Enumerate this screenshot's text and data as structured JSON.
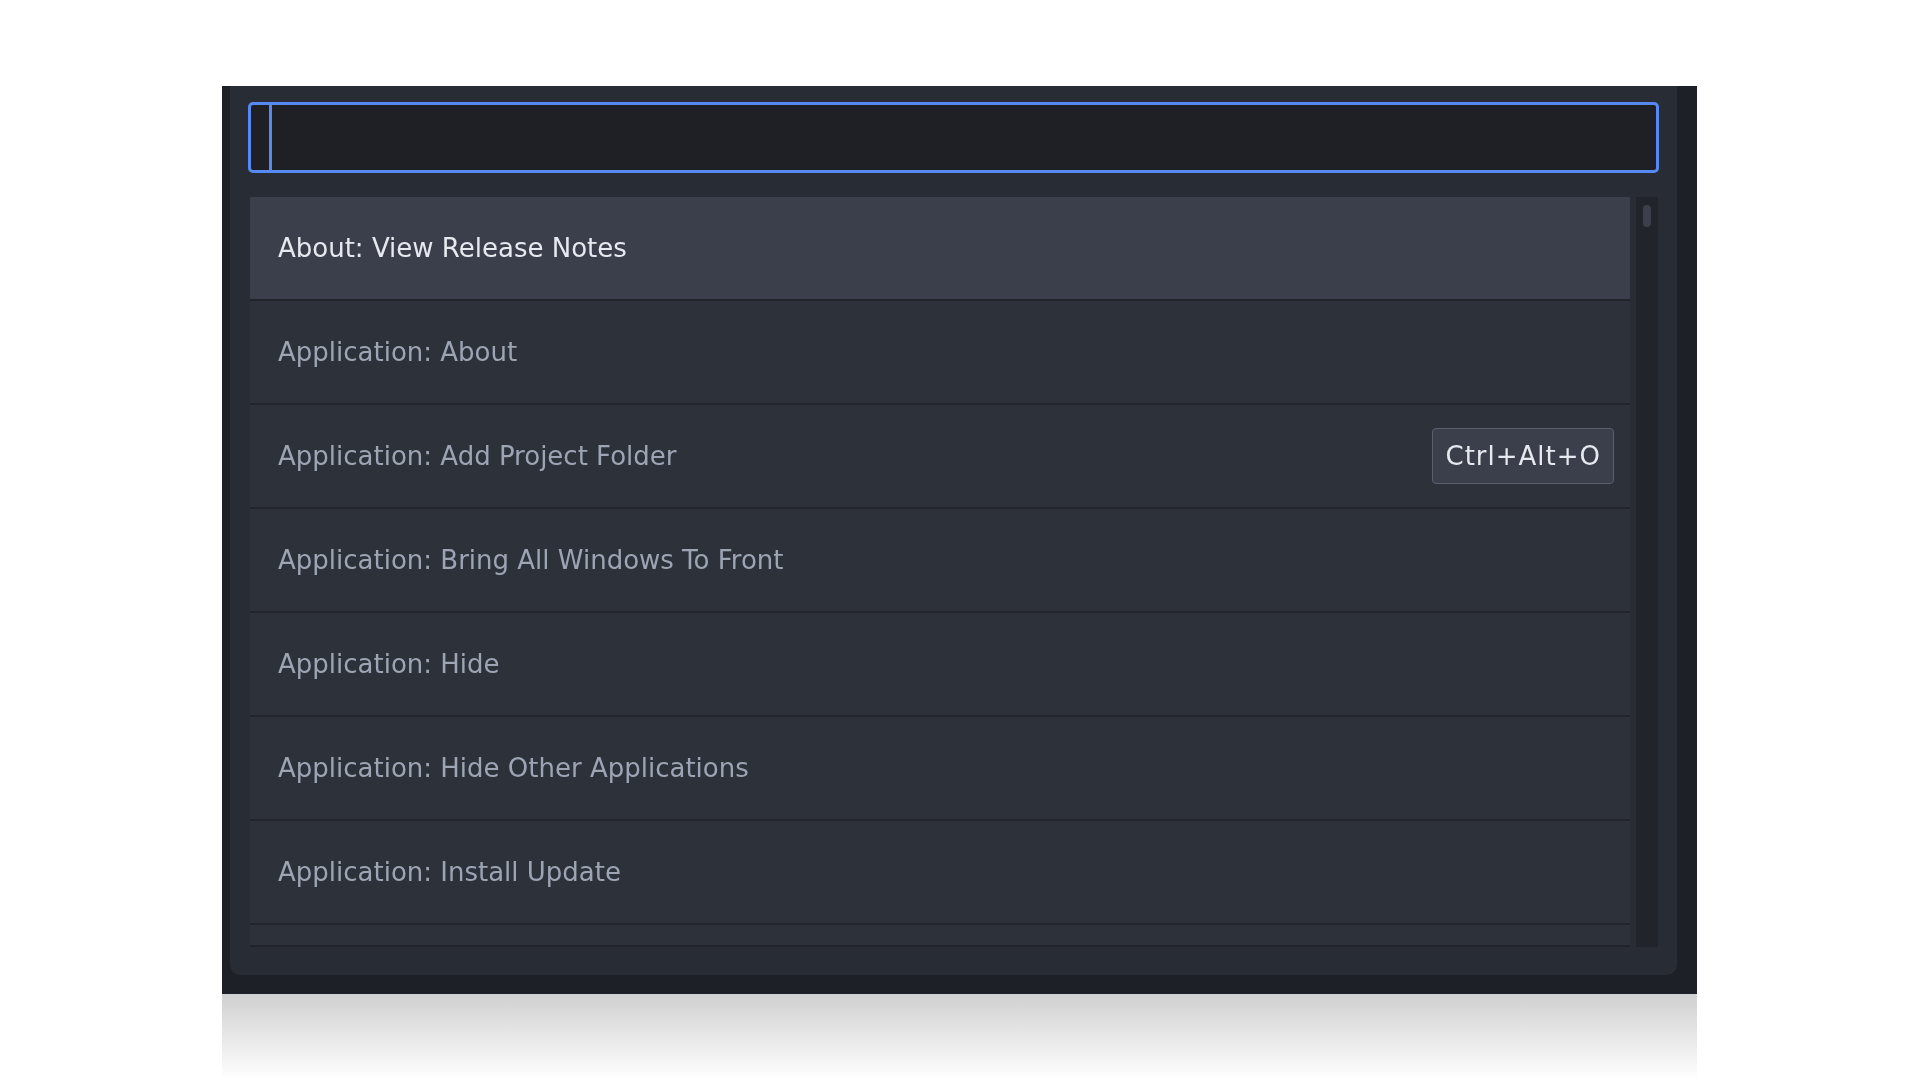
{
  "command_palette": {
    "items": [
      {
        "label": "About: View Release Notes",
        "selected": true
      },
      {
        "label": "Application: About",
        "selected": false
      },
      {
        "label": "Application: Add Project Folder",
        "selected": false,
        "shortcut": "Ctrl+Alt+O"
      },
      {
        "label": "Application: Bring All Windows To Front",
        "selected": false
      },
      {
        "label": "Application: Hide",
        "selected": false
      },
      {
        "label": "Application: Hide Other Applications",
        "selected": false
      },
      {
        "label": "Application: Install Update",
        "selected": false
      }
    ]
  }
}
